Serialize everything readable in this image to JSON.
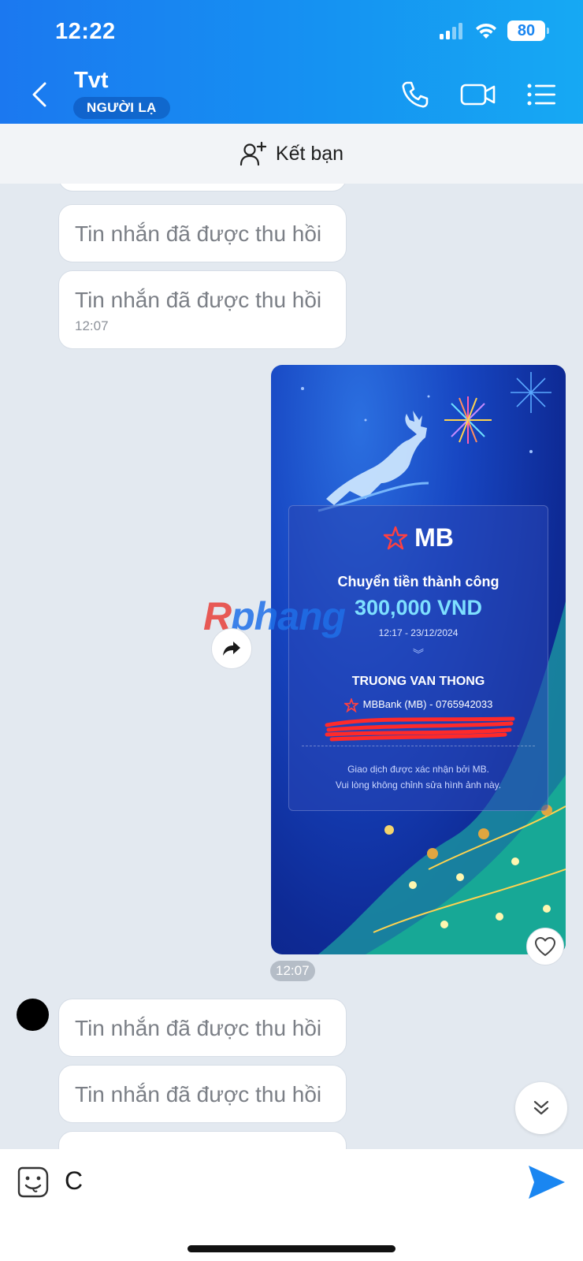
{
  "status_bar": {
    "time": "12:22",
    "battery": "80"
  },
  "header": {
    "name": "Tvt",
    "badge": "NGƯỜI LẠ"
  },
  "friend_bar": {
    "label": "Kết bạn"
  },
  "messages_top": [
    {
      "text": "Tin nhắn đã được thu hồi"
    },
    {
      "text": "Tin nhắn đã được thu hồi",
      "time": "12:07"
    }
  ],
  "image_message": {
    "time": "12:07",
    "receipt": {
      "brand": "MB",
      "title": "Chuyển tiền thành công",
      "amount": "300,000 VND",
      "datetime": "12:17 - 23/12/2024",
      "recipient": "TRUONG VAN THONG",
      "bank_account": "MBBank (MB) - 0765942033",
      "note_line1": "Giao dịch được xác nhận bởi MB.",
      "note_line2": "Vui lòng không chỉnh sửa hình ảnh này."
    },
    "watermark": {
      "prefix": "R",
      "rest": "phang"
    }
  },
  "messages_bottom": [
    {
      "text": "Tin nhắn đã được thu hồi"
    },
    {
      "text": "Tin nhắn đã được thu hồi"
    }
  ],
  "composer": {
    "value": "C"
  }
}
